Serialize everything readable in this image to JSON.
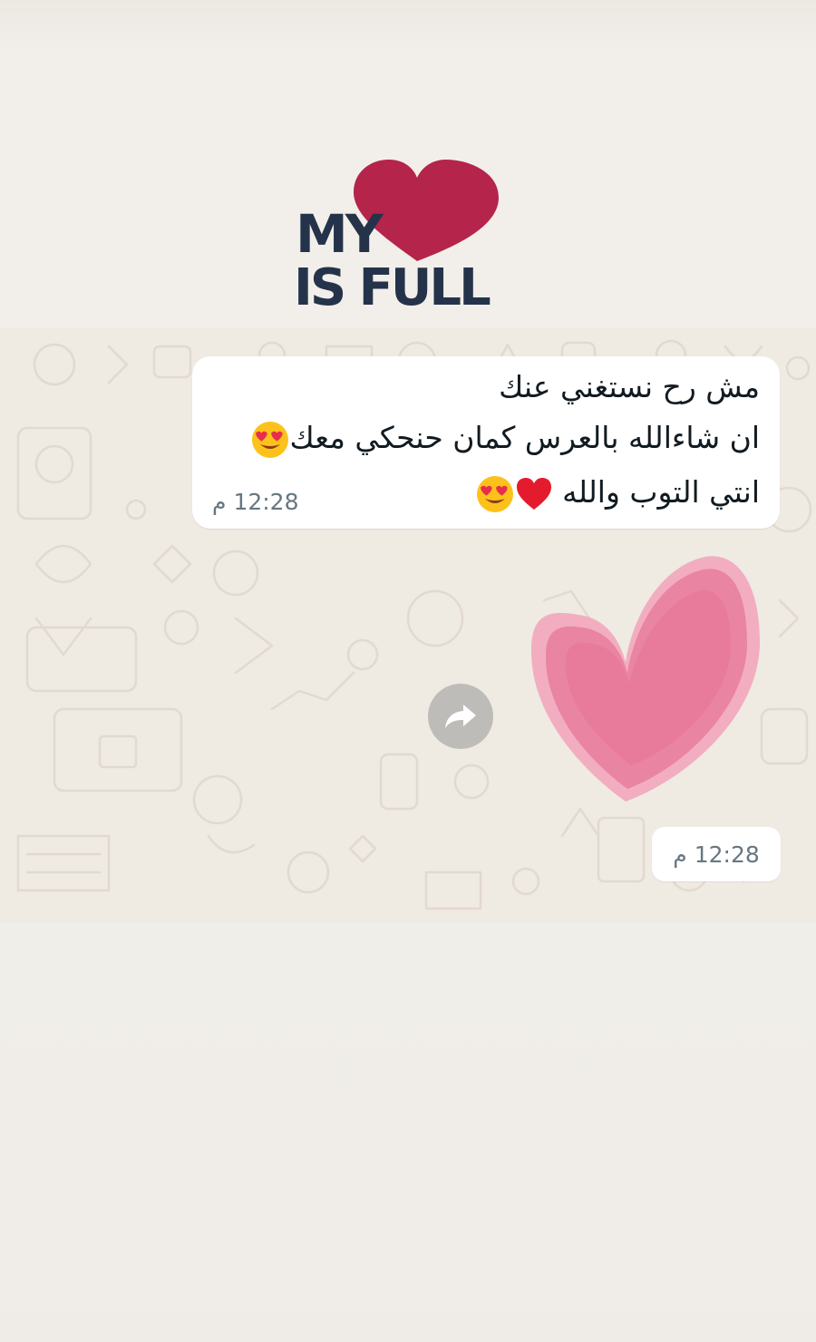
{
  "sticker_top": {
    "line1": "MY",
    "line2": "IS FULL",
    "text_color": "#25334a",
    "heart_color": "#b5244b"
  },
  "incoming_message": {
    "line1": "مش رح نستغني عنك",
    "line2": "ان شاءالله بالعرس كمان حنحكي معك",
    "line3": "انتي التوب والله",
    "emoji_line2": "heart-eyes-emoji",
    "emoji_line3": [
      "heart-eyes-emoji",
      "red-heart-emoji"
    ],
    "time": "12:28 م"
  },
  "forward_button": {
    "icon": "forward-arrow-icon"
  },
  "sticker_heart": {
    "color": "#ec7fa0"
  },
  "outgoing_sticker_time": "12:28 م",
  "colors": {
    "chat_background": "#efeae2",
    "bubble": "#ffffff",
    "text": "#111b21",
    "timestamp": "#667781"
  }
}
